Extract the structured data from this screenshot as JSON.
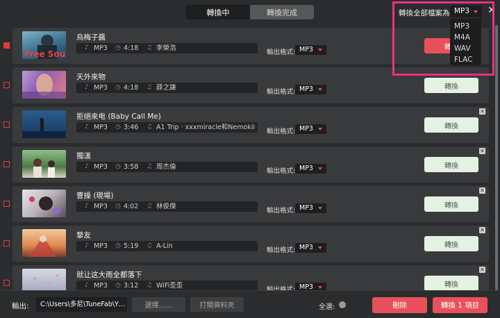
{
  "tabs": [
    {
      "label": "轉換中"
    },
    {
      "label": "轉換完成"
    }
  ],
  "convert_all": {
    "label": "轉換全部檔案為:",
    "value": "MP3"
  },
  "dropdown_options": [
    "MP3",
    "M4A",
    "WAV",
    "FLAC"
  ],
  "row_common": {
    "output_format_label": "輸出格式:",
    "convert_label": "轉換"
  },
  "songs": [
    {
      "title": "烏梅子醬",
      "format": "MP3",
      "duration": "4:18",
      "artist": "李榮浩",
      "output": "MP3",
      "checked": true
    },
    {
      "title": "天外來物",
      "format": "MP3",
      "duration": "4:18",
      "artist": "薛之謙",
      "output": "MP3",
      "checked": false
    },
    {
      "title": "拒絕來电 (Baby Call Me)",
      "format": "MP3",
      "duration": "3:46",
      "artist": "A1 Trip · xxxmiracle和Nemokii",
      "output": "MP3",
      "checked": false
    },
    {
      "title": "獨漾",
      "format": "MP3",
      "duration": "3:58",
      "artist": "周杰倫",
      "output": "MP3",
      "checked": false
    },
    {
      "title": "曹操 (現場)",
      "format": "MP3",
      "duration": "4:02",
      "artist": "林俊傑",
      "output": "MP3",
      "checked": false
    },
    {
      "title": "摯友",
      "format": "MP3",
      "duration": "5:19",
      "artist": "A-Lin",
      "output": "MP3",
      "checked": false
    },
    {
      "title": "就让这大雨全都落下",
      "format": "MP3",
      "duration": "3:12",
      "artist": "WiFi歪歪",
      "output": "MP3",
      "checked": false
    }
  ],
  "thumb1_text": "Free Soul",
  "bottom": {
    "output_label": "輸出:",
    "path": "C:\\Users\\多尼\\TuneFab\\Y…",
    "choose_label": "選擇……",
    "open_folder_label": "打開資料夾",
    "select_all_label": "全選:",
    "delete_label": "刪除",
    "convert_items_label": "轉換 1 項目"
  },
  "colors": {
    "accent": "#e8505b",
    "highlight": "#e8337f",
    "convert_bg": "#e4f2e4"
  }
}
